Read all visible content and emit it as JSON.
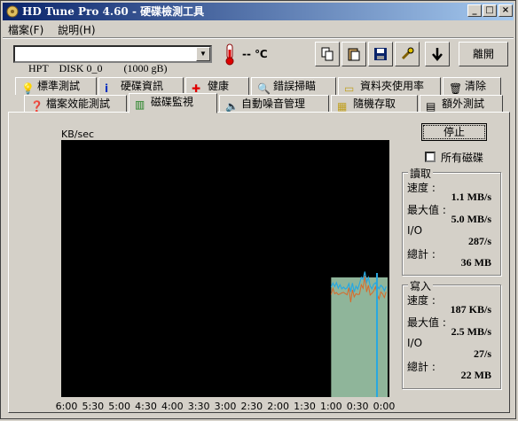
{
  "window": {
    "title": "HD Tune Pro 4.60 - 硬碟檢測工具"
  },
  "titlebar_buttons": {
    "minimize": "_",
    "maximize": "□",
    "close": "×"
  },
  "menu": [
    "檔案(F)",
    "說明(H)"
  ],
  "toolbar": {
    "drive": "HPT    DISK 0_0        (1000 gB)",
    "temperature": "-- ℃",
    "exit_label": "離開"
  },
  "tabs_row1": [
    {
      "label": "標準測試",
      "icon": "lightbulb-icon"
    },
    {
      "label": "硬碟資訊",
      "icon": "info-icon"
    },
    {
      "label": "健康",
      "icon": "red-cross-icon"
    },
    {
      "label": "錯誤掃瞄",
      "icon": "magnifier-icon"
    },
    {
      "label": "資料夾使用率",
      "icon": "folder-icon"
    },
    {
      "label": "清除",
      "icon": "trash-icon"
    }
  ],
  "tabs_row2": [
    {
      "label": "檔案效能測試",
      "icon": "file-benchmark-icon"
    },
    {
      "label": "磁碟監視",
      "icon": "disk-monitor-icon"
    },
    {
      "label": "自動噪音管理",
      "icon": "speaker-icon"
    },
    {
      "label": "隨機存取",
      "icon": "random-access-icon"
    },
    {
      "label": "額外測試",
      "icon": "extra-tests-icon"
    }
  ],
  "active_tab": "磁碟監視",
  "monitor": {
    "stop_label": "停止",
    "all_disks_label": "所有磁碟",
    "all_disks_checked": false,
    "read": {
      "title": "讀取",
      "speed_label": "速度 :",
      "speed": "1.1 MB/s",
      "max_label": "最大值 :",
      "max": "5.0 MB/s",
      "io_label": "I/O",
      "io": "287/s",
      "total_label": "總計 :",
      "total": "36 MB"
    },
    "write": {
      "title": "寫入",
      "speed_label": "速度 :",
      "speed": "187 KB/s",
      "max_label": "最大值 :",
      "max": "2.5 MB/s",
      "io_label": "I/O",
      "io": "27/s",
      "total_label": "總計 :",
      "total": "22 MB"
    }
  },
  "chart_data": {
    "type": "area",
    "ylabel": "KB/sec",
    "xticks": [
      "6:00",
      "5:30",
      "5:00",
      "4:30",
      "4:00",
      "3:30",
      "3:00",
      "2:30",
      "2:00",
      "1:30",
      "1:00",
      "0:30",
      "0:00"
    ],
    "colors": {
      "background": "#000000",
      "fill": "#8fb59a",
      "read": "#29a8e0",
      "write": "#d86a2a"
    },
    "recent_activity_start": "1:00",
    "series": []
  }
}
